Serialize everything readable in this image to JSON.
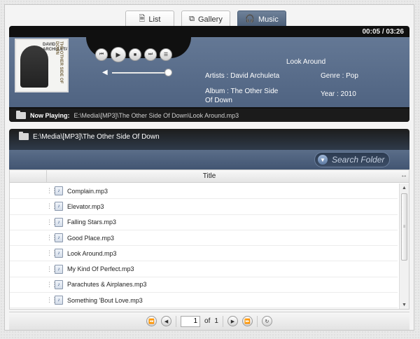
{
  "tabs": [
    {
      "label": "List",
      "icon": "document-icon"
    },
    {
      "label": "Gallery",
      "icon": "gallery-icon"
    },
    {
      "label": "Music",
      "icon": "headphones-icon",
      "active": true
    }
  ],
  "player": {
    "time": "00:05 / 03:26",
    "album_art": {
      "artist": "DAVID ARCHULETA",
      "title": "THE OTHER SIDE OF DOWN"
    },
    "track_title": "Look Around",
    "artists_label": "Artists : David Archuleta",
    "album_label": "Album : The Other Side Of Down",
    "genre_label": "Genre : Pop",
    "year_label": "Year : 2010",
    "volume": 1.0,
    "now_playing_label": "Now Playing:",
    "now_playing_path": "E:\\Media\\[MP3]\\The Other Side Of Down\\Look Around.mp3"
  },
  "folder": {
    "path": "E:\\Media\\[MP3]\\The Other Side Of Down"
  },
  "search": {
    "placeholder": "Search Folder"
  },
  "grid": {
    "column_title": "Title",
    "rows": [
      "Complain.mp3",
      "Elevator.mp3",
      "Falling Stars.mp3",
      "Good Place.mp3",
      "Look Around.mp3",
      "My Kind Of Perfect.mp3",
      "Parachutes & Airplanes.mp3",
      "Something 'Bout Love.mp3"
    ]
  },
  "pager": {
    "page": "1",
    "of_label": "of",
    "total": "1"
  }
}
